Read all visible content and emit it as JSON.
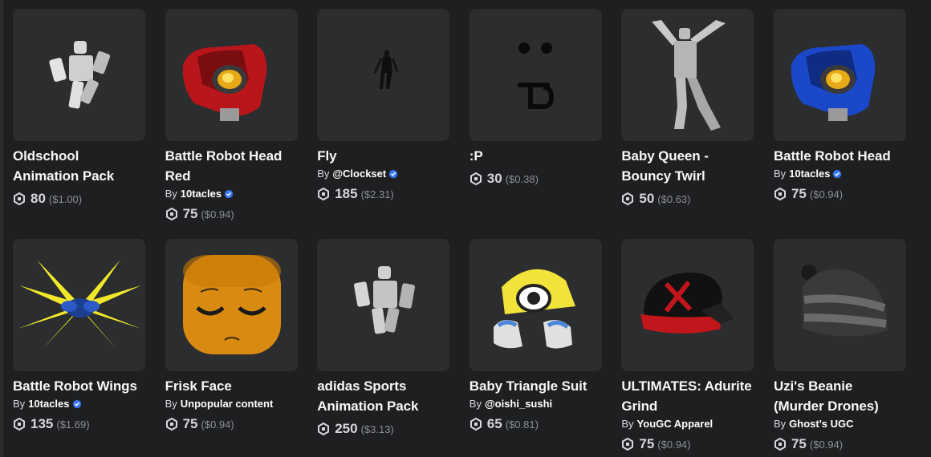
{
  "items": [
    {
      "name": "Oldschool Animation Pack",
      "creator": "",
      "verified": false,
      "price": "80",
      "usd": "($1.00)",
      "image": "oldschool-animation-figure"
    },
    {
      "name": "Battle Robot Head Red",
      "creator": "10tacles",
      "verified": true,
      "price": "75",
      "usd": "($0.94)",
      "image": "red-robot-head"
    },
    {
      "name": "Fly",
      "creator": "@Clockset",
      "verified": true,
      "price": "185",
      "usd": "($2.31)",
      "image": "tiny-fly-figure"
    },
    {
      "name": ":P",
      "creator": "",
      "verified": false,
      "price": "30",
      "usd": "($0.38)",
      "image": "tongue-face"
    },
    {
      "name": "Baby Queen - Bouncy Twirl",
      "creator": "",
      "verified": false,
      "price": "50",
      "usd": "($0.63)",
      "image": "dancing-figure"
    },
    {
      "name": "Battle Robot Head",
      "creator": "10tacles",
      "verified": true,
      "price": "75",
      "usd": "($0.94)",
      "image": "blue-robot-head"
    },
    {
      "name": "Battle Robot Wings",
      "creator": "10tacles",
      "verified": true,
      "price": "135",
      "usd": "($1.69)",
      "image": "robot-wings"
    },
    {
      "name": "Frisk Face",
      "creator": "Unpopular content",
      "verified": false,
      "price": "75",
      "usd": "($0.94)",
      "image": "frisk-face"
    },
    {
      "name": "adidas Sports Animation Pack",
      "creator": "",
      "verified": false,
      "price": "250",
      "usd": "($3.13)",
      "image": "adidas-animation-figure"
    },
    {
      "name": "Baby Triangle Suit",
      "creator": "@oishi_sushi",
      "verified": false,
      "price": "65",
      "usd": "($0.81)",
      "image": "triangle-suit"
    },
    {
      "name": "ULTIMATES: Adurite Grind",
      "creator": "YouGC Apparel",
      "verified": false,
      "price": "75",
      "usd": "($0.94)",
      "image": "black-red-cap"
    },
    {
      "name": "Uzi's Beanie (Murder Drones)",
      "creator": "Ghost's UGC",
      "verified": false,
      "price": "75",
      "usd": "($0.94)",
      "image": "gray-beanie"
    }
  ],
  "labels": {
    "by": "By"
  },
  "colors": {
    "tile": "#2c2d2f",
    "background": "#1e1f21",
    "verified": "#3a7bfd"
  }
}
